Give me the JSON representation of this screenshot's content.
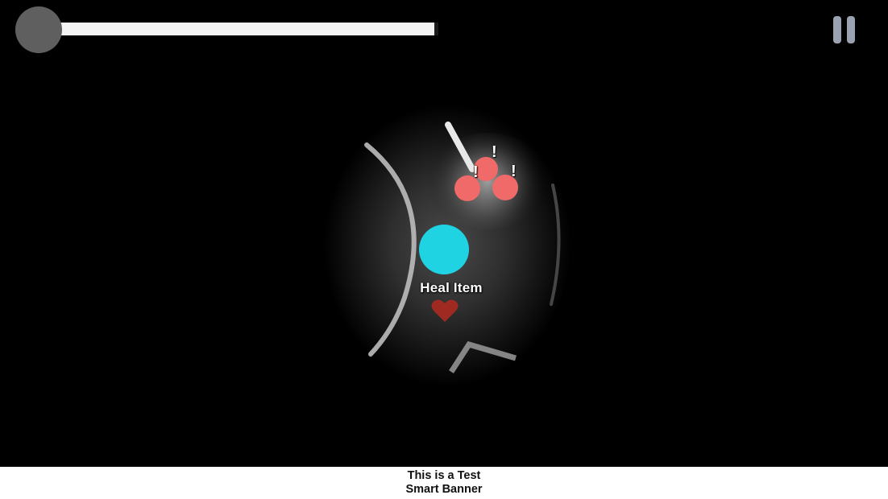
{
  "hud": {
    "health_fraction": 0.99,
    "bar_color": "#f4f4f4",
    "avatar_color": "#5f5f5f",
    "pause_icon": "pause-icon"
  },
  "scene": {
    "player_color": "#1fd3e2",
    "enemy_color": "#f06a6a",
    "heart_color": "#9e2a22",
    "item_label": "Heal Item",
    "enemy_alert_mark": "!"
  },
  "banner": {
    "line1": "This is a Test",
    "line2": "Smart Banner"
  }
}
